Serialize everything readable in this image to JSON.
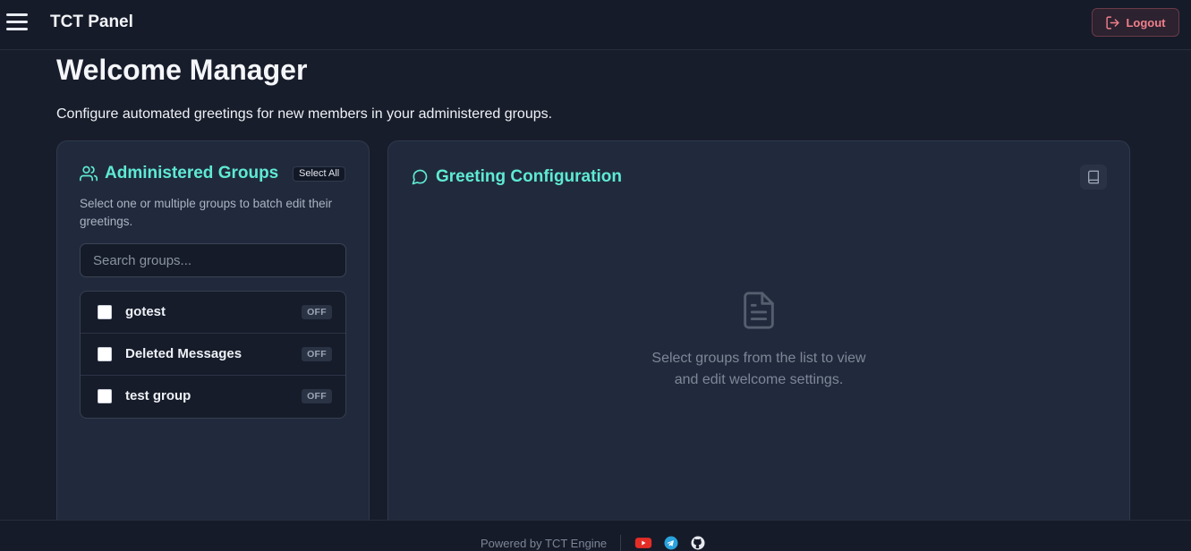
{
  "header": {
    "app_title": "TCT Panel",
    "logout_label": "Logout",
    "menu_icon": "hamburger-menu-icon",
    "logout_icon": "logout-icon"
  },
  "page": {
    "title": "Welcome Manager",
    "subtitle": "Configure automated greetings for new members in your administered groups."
  },
  "groups_panel": {
    "title": "Administered Groups",
    "select_all_label": "Select All",
    "description": "Select one or multiple groups to batch edit their greetings.",
    "search_placeholder": "Search groups...",
    "search_value": "",
    "groups": [
      {
        "name": "gotest",
        "status": "OFF",
        "checked": false
      },
      {
        "name": "Deleted Messages",
        "status": "OFF",
        "checked": false
      },
      {
        "name": "test group",
        "status": "OFF",
        "checked": false
      }
    ]
  },
  "config_panel": {
    "title": "Greeting Configuration",
    "empty_message": "Select groups from the list to view and edit welcome settings.",
    "help_icon": "book-icon",
    "empty_icon": "document-icon"
  },
  "footer": {
    "powered_by": "Powered by TCT Engine",
    "social": [
      "youtube-icon",
      "telegram-icon",
      "github-icon"
    ]
  },
  "colors": {
    "accent": "#5eead4",
    "background": "#181d2b",
    "card": "#212a3c",
    "logout": "#f0808a"
  }
}
